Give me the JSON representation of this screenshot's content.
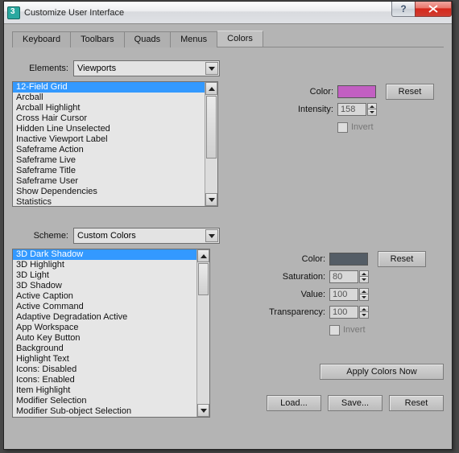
{
  "window": {
    "title": "Customize User Interface"
  },
  "tabs": [
    "Keyboard",
    "Toolbars",
    "Quads",
    "Menus",
    "Colors"
  ],
  "elements": {
    "label": "Elements:",
    "value": "Viewports",
    "list": [
      {
        "label": "12-Field Grid",
        "selected": true
      },
      {
        "label": "Arcball"
      },
      {
        "label": "Arcball Highlight"
      },
      {
        "label": "Cross Hair Cursor"
      },
      {
        "label": "Hidden Line Unselected"
      },
      {
        "label": "Inactive Viewport Label"
      },
      {
        "label": "Safeframe Action"
      },
      {
        "label": "Safeframe Live"
      },
      {
        "label": "Safeframe Title"
      },
      {
        "label": "Safeframe User"
      },
      {
        "label": "Show Dependencies"
      },
      {
        "label": "Statistics"
      }
    ],
    "controls": {
      "color_label": "Color:",
      "color_value": "#c25fc2",
      "reset_label": "Reset",
      "intensity_label": "Intensity:",
      "intensity_value": "158",
      "invert_label": "Invert"
    }
  },
  "scheme": {
    "label": "Scheme:",
    "value": "Custom Colors",
    "list": [
      {
        "label": "3D Dark Shadow",
        "selected": true
      },
      {
        "label": "3D Highlight"
      },
      {
        "label": "3D Light"
      },
      {
        "label": "3D Shadow"
      },
      {
        "label": "Active Caption"
      },
      {
        "label": "Active Command"
      },
      {
        "label": "Adaptive Degradation Active"
      },
      {
        "label": "App Workspace"
      },
      {
        "label": "Auto Key Button"
      },
      {
        "label": "Background"
      },
      {
        "label": "Highlight Text"
      },
      {
        "label": "Icons: Disabled"
      },
      {
        "label": "Icons: Enabled"
      },
      {
        "label": "Item Highlight"
      },
      {
        "label": "Modifier Selection"
      },
      {
        "label": "Modifier Sub-object Selection"
      }
    ],
    "controls": {
      "color_label": "Color:",
      "color_value": "#545d66",
      "reset_label": "Reset",
      "saturation_label": "Saturation:",
      "saturation_value": "80",
      "value_label": "Value:",
      "value_value": "100",
      "transparency_label": "Transparency:",
      "transparency_value": "100",
      "invert_label": "Invert"
    }
  },
  "buttons": {
    "apply": "Apply Colors Now",
    "load": "Load...",
    "save": "Save...",
    "reset": "Reset"
  }
}
